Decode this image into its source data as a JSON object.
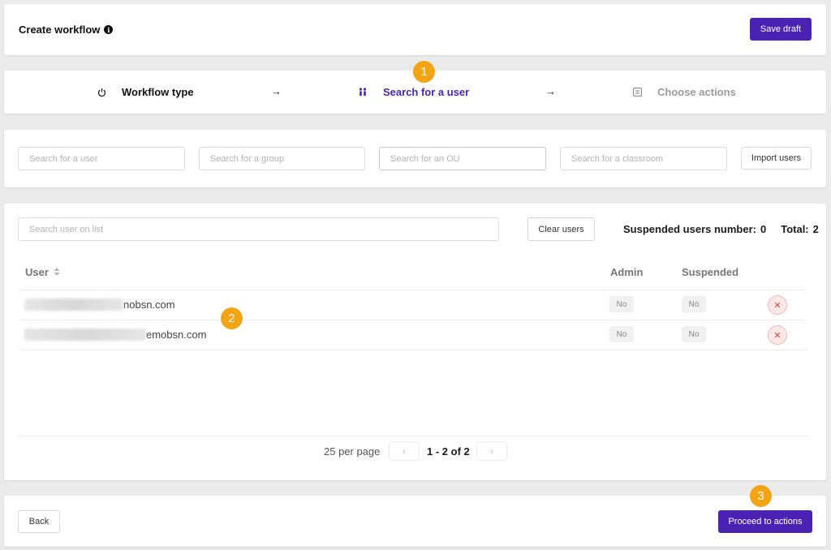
{
  "header": {
    "title": "Create workflow",
    "info_icon": "info-icon",
    "save_label": "Save draft"
  },
  "steps": [
    {
      "label": "Workflow type",
      "icon": "power-icon",
      "state": "done"
    },
    {
      "label": "Search for a user",
      "icon": "users-icon",
      "state": "active"
    },
    {
      "label": "Choose actions",
      "icon": "checklist-icon",
      "state": "pending"
    }
  ],
  "callouts": [
    "1",
    "2",
    "3"
  ],
  "search": {
    "user_placeholder": "Search for a user",
    "group_placeholder": "Search for a group",
    "ou_placeholder": "Search for an OU",
    "classroom_placeholder": "Search for a classroom",
    "import_label": "Import users"
  },
  "list": {
    "search_placeholder": "Search user on list",
    "clear_label": "Clear users",
    "suspended_label": "Suspended users number:",
    "suspended_value": "0",
    "total_label": "Total:",
    "total_value": "2",
    "columns": {
      "user": "User",
      "admin": "Admin",
      "suspended": "Suspended"
    },
    "rows": [
      {
        "email_suffix": "nobsn.com",
        "admin": "No",
        "suspended": "No"
      },
      {
        "email_suffix": "emobsn.com",
        "admin": "No",
        "suspended": "No"
      }
    ],
    "pagination": {
      "per_page": "25 per page",
      "range": "1 - 2 of 2"
    }
  },
  "footer": {
    "back_label": "Back",
    "proceed_label": "Proceed to actions"
  },
  "colors": {
    "accent": "#4a23b4",
    "callout": "#f4a413",
    "background": "#ebebeb"
  }
}
